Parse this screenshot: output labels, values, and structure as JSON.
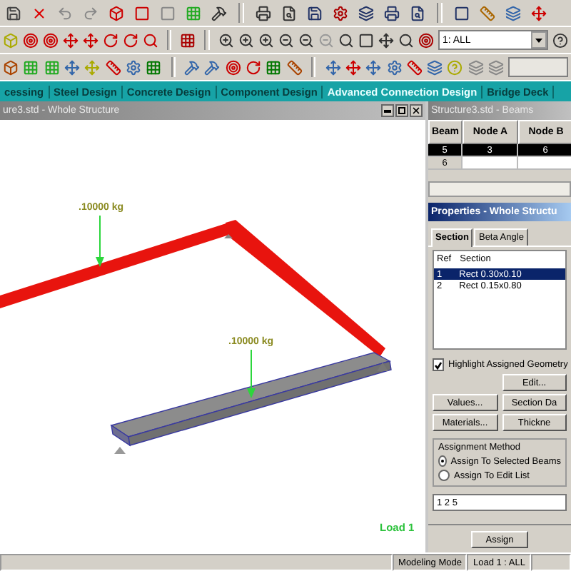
{
  "toolbar": {
    "view_dropdown": {
      "value": "1: ALL"
    }
  },
  "modules": [
    {
      "label": "cessing",
      "selected": false
    },
    {
      "label": "Steel Design",
      "selected": false
    },
    {
      "label": "Concrete Design",
      "selected": false
    },
    {
      "label": "Component Design",
      "selected": false
    },
    {
      "label": "Advanced Connection Design",
      "selected": true
    },
    {
      "label": "Bridge Deck",
      "selected": false
    }
  ],
  "viewport": {
    "title": "ure3.std - Whole Structure",
    "load_labels": [
      ".10000 kg",
      ".10000 kg"
    ],
    "load_case": "Load 1"
  },
  "beams_table": {
    "title": "Structure3.std - Beams",
    "columns": [
      "Beam",
      "Node A",
      "Node B"
    ],
    "rows": [
      {
        "cells": [
          "5",
          "3",
          "6"
        ],
        "selected": true
      },
      {
        "cells": [
          "6"
        ],
        "selected": false
      }
    ]
  },
  "properties": {
    "title": "Properties - Whole Structu",
    "tabs": [
      {
        "label": "Section",
        "selected": true
      },
      {
        "label": "Beta Angle",
        "selected": false
      }
    ],
    "columns": [
      "Ref",
      "Section"
    ],
    "rows": [
      {
        "ref": "1",
        "section": "Rect 0.30x0.10",
        "selected": true
      },
      {
        "ref": "2",
        "section": "Rect 0.15x0.80",
        "selected": false
      }
    ],
    "highlight": {
      "label": "Highlight Assigned Geometry",
      "checked": true
    },
    "edit_button": "Edit...",
    "buttons": [
      "Values...",
      "Section Da",
      "Materials...",
      "Thickne"
    ],
    "assignment": {
      "title": "Assignment Method",
      "options": [
        {
          "label": "Assign To Selected Beams",
          "selected": true
        },
        {
          "label": "Assign To Edit List",
          "selected": false
        }
      ]
    },
    "edit_list": "1 2 5",
    "assign_button": "Assign"
  },
  "status_bar": [
    "Modeling Mode",
    "Load 1 : ALL"
  ]
}
